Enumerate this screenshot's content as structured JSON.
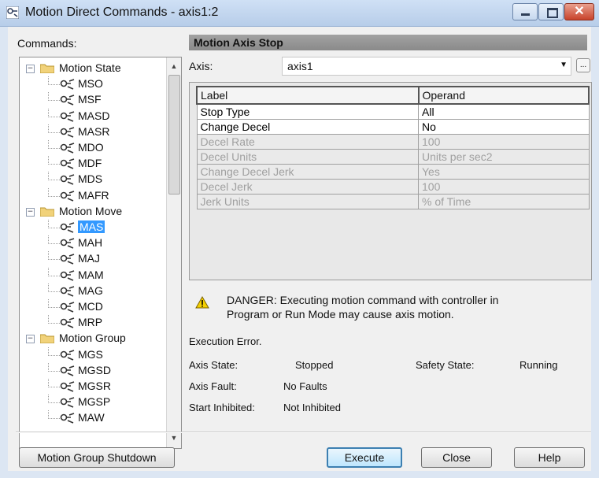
{
  "window": {
    "title": "Motion Direct Commands - axis1:2",
    "accent_color": "#3399ff",
    "close_glyph": "✕"
  },
  "left": {
    "commands_label": "Commands:",
    "tree": [
      {
        "type": "group",
        "label": "Motion State",
        "expanded": true
      },
      {
        "type": "cmd",
        "label": "MSO"
      },
      {
        "type": "cmd",
        "label": "MSF"
      },
      {
        "type": "cmd",
        "label": "MASD"
      },
      {
        "type": "cmd",
        "label": "MASR"
      },
      {
        "type": "cmd",
        "label": "MDO"
      },
      {
        "type": "cmd",
        "label": "MDF"
      },
      {
        "type": "cmd",
        "label": "MDS"
      },
      {
        "type": "cmd",
        "label": "MAFR"
      },
      {
        "type": "group",
        "label": "Motion Move",
        "expanded": true
      },
      {
        "type": "cmd",
        "label": "MAS",
        "selected": true
      },
      {
        "type": "cmd",
        "label": "MAH"
      },
      {
        "type": "cmd",
        "label": "MAJ"
      },
      {
        "type": "cmd",
        "label": "MAM"
      },
      {
        "type": "cmd",
        "label": "MAG"
      },
      {
        "type": "cmd",
        "label": "MCD"
      },
      {
        "type": "cmd",
        "label": "MRP"
      },
      {
        "type": "group",
        "label": "Motion Group",
        "expanded": true
      },
      {
        "type": "cmd",
        "label": "MGS"
      },
      {
        "type": "cmd",
        "label": "MGSD"
      },
      {
        "type": "cmd",
        "label": "MGSR"
      },
      {
        "type": "cmd",
        "label": "MGSP"
      },
      {
        "type": "cmd",
        "label": "MAW"
      }
    ]
  },
  "right": {
    "section_title": "Motion Axis Stop",
    "axis_label": "Axis:",
    "axis_value": "axis1",
    "browse_label": "...",
    "grid_headers": [
      "Label",
      "Operand"
    ],
    "grid_rows": [
      {
        "label": "Stop Type",
        "operand": "All",
        "enabled": true
      },
      {
        "label": "Change Decel",
        "operand": "No",
        "enabled": true
      },
      {
        "label": "Decel Rate",
        "operand": "100",
        "enabled": false
      },
      {
        "label": "Decel Units",
        "operand": "Units per sec2",
        "enabled": false
      },
      {
        "label": "Change Decel Jerk",
        "operand": "Yes",
        "enabled": false
      },
      {
        "label": "Decel Jerk",
        "operand": "100",
        "enabled": false
      },
      {
        "label": "Jerk Units",
        "operand": "% of Time",
        "enabled": false
      }
    ],
    "warning_line1": "DANGER: Executing motion command with controller in",
    "warning_line2": "Program or Run Mode may cause axis motion.",
    "execution_error": "Execution Error.",
    "axis_state_label": "Axis State:",
    "axis_state_value": "Stopped",
    "safety_state_label": "Safety State:",
    "safety_state_value": "Running",
    "axis_fault_label": "Axis Fault:",
    "axis_fault_value": "No Faults",
    "start_inhibited_label": "Start Inhibited:",
    "start_inhibited_value": "Not Inhibited"
  },
  "buttons": {
    "shutdown": "Motion Group Shutdown",
    "execute": "Execute",
    "close": "Close",
    "help": "Help"
  }
}
